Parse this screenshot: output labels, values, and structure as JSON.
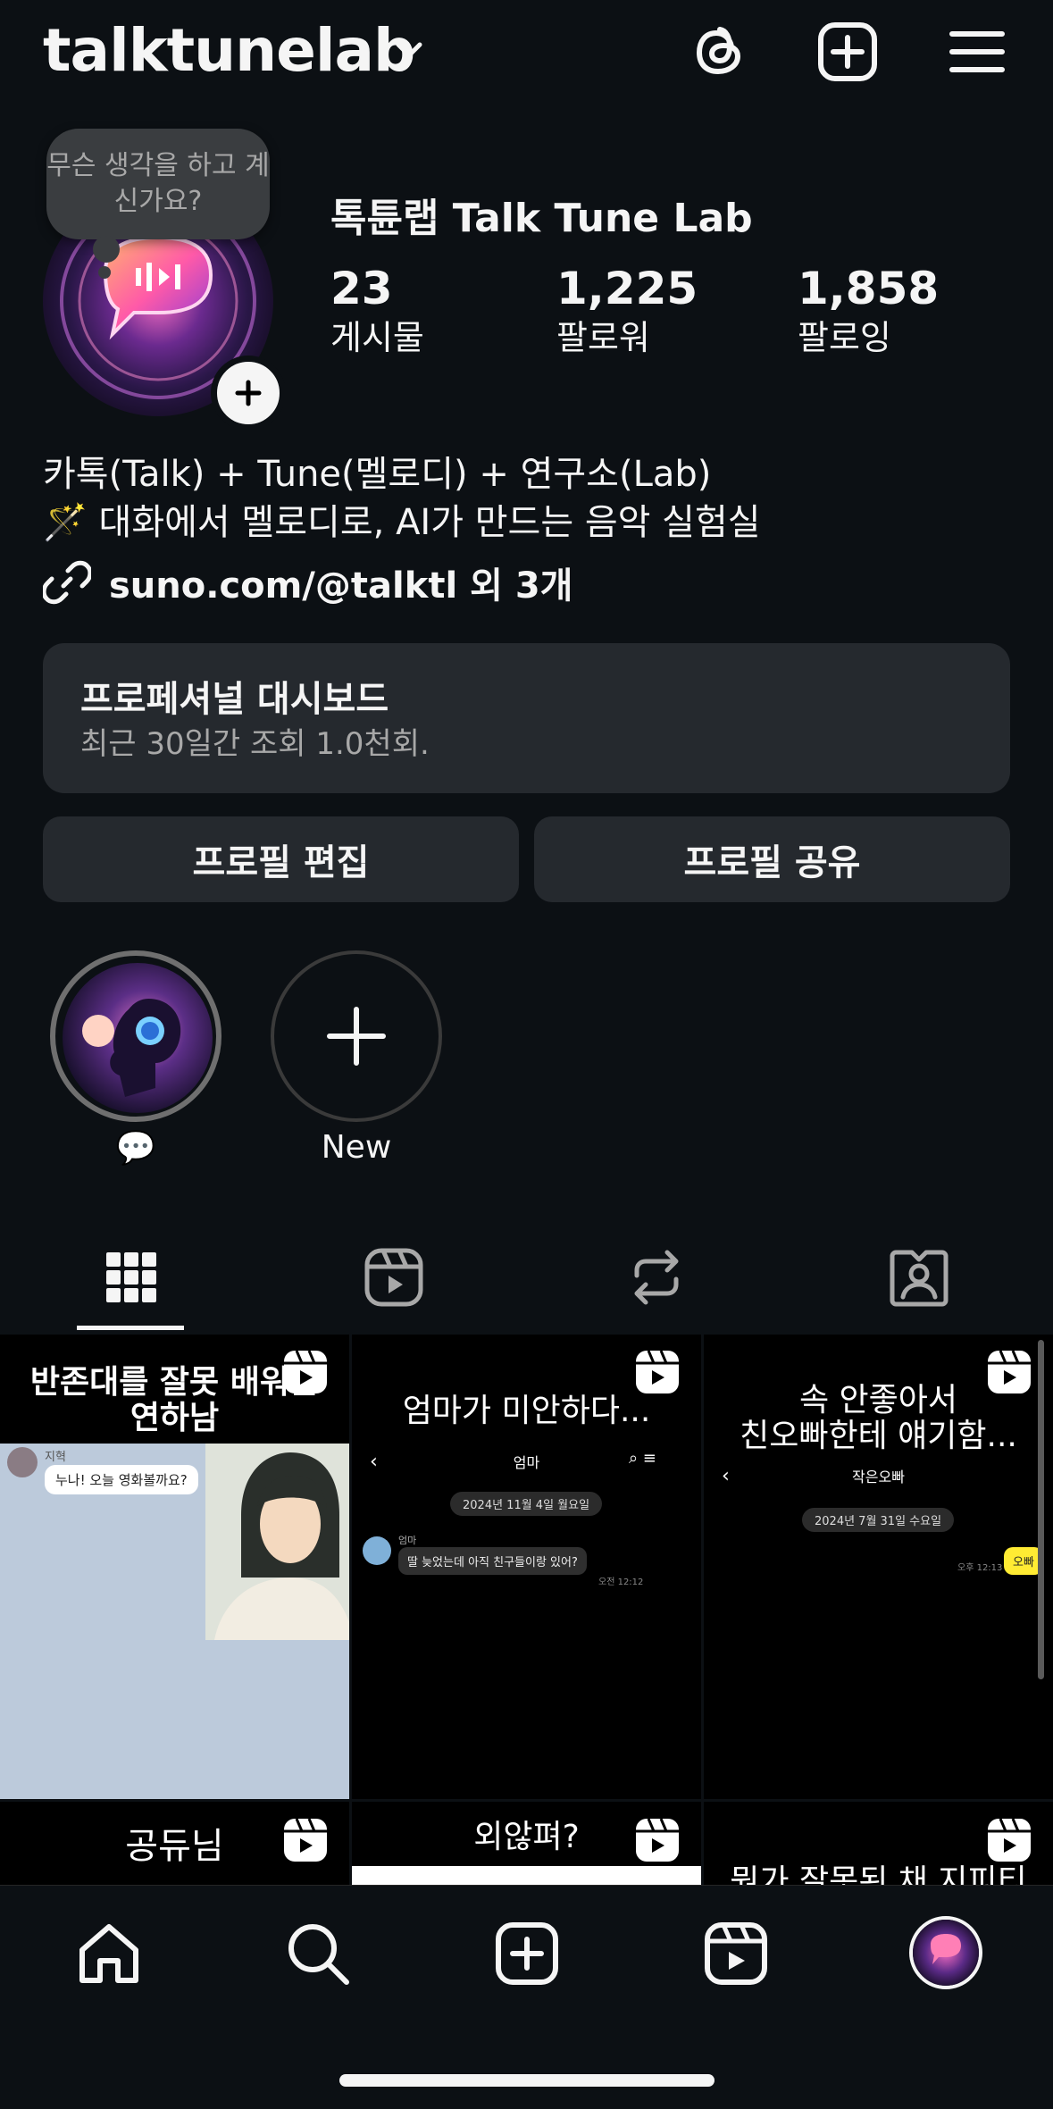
{
  "header": {
    "username": "talktunelab"
  },
  "profile": {
    "note_text": "무슨 생각을 하고 계신가요?",
    "display_name": "톡튠랩 Talk Tune Lab",
    "stats": [
      {
        "value": "23",
        "label": "게시물"
      },
      {
        "value": "1,225",
        "label": "팔로워"
      },
      {
        "value": "1,858",
        "label": "팔로잉"
      }
    ],
    "bio_line1": "카톡(Talk) + Tune(멜로디) + 연구소(Lab)",
    "bio_line2": "🪄 대화에서 멜로디로, AI가 만드는 음악 실험실",
    "link_text": "suno.com/@talktl 외 3개"
  },
  "dashboard": {
    "title": "프로페셔널 대시보드",
    "subtitle": "최근 30일간 조회 1.0천회."
  },
  "buttons": {
    "edit_profile": "프로필 편집",
    "share_profile": "프로필 공유"
  },
  "highlights": [
    {
      "label": "💬"
    },
    {
      "label": "New"
    }
  ],
  "grid": {
    "posts": [
      {
        "title": "반존대를 잘못 배워온\n연하남",
        "chat_name": "지혁",
        "chat_bubble": "누나! 오늘 영화볼까요?"
      },
      {
        "title": "엄마가 미안하다...",
        "chat_header": "엄마",
        "chat_date": "2024년 11월 4일 월요일",
        "chat_name": "엄마",
        "chat_bubble": "딸 늦었는데 아직 친구들이랑 있어?",
        "chat_time": "오전 12:12"
      },
      {
        "title": "속 안좋아서\n친오빠한테 얘기함...",
        "chat_header": "작은오빠",
        "chat_date": "2024년 7월 31일 수요일",
        "chat_bubble": "오빠",
        "chat_time": "오후 12:13"
      },
      {
        "title": "공듀님"
      },
      {
        "title": "외않펴?"
      },
      {
        "title": "뭔가 잘못된 채 지피티"
      }
    ]
  },
  "colors": {
    "background": "#0c1014",
    "surface": "#25292e",
    "text": "#f5f5f5",
    "muted": "#a8a8a8"
  }
}
